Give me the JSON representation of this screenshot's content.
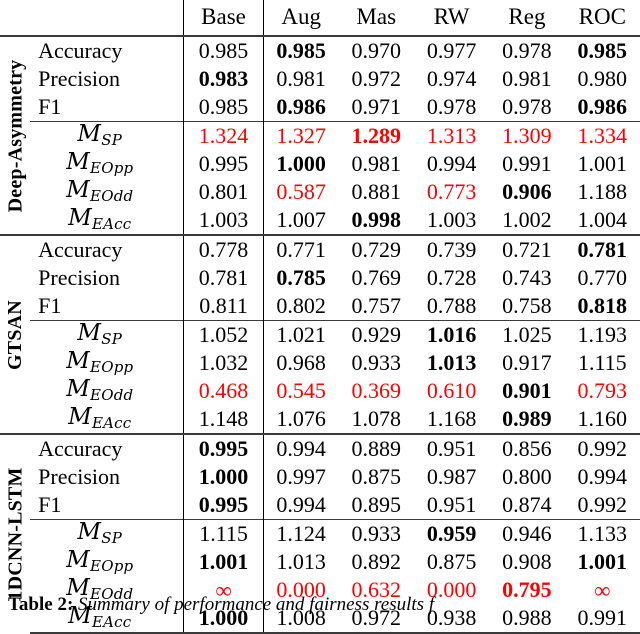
{
  "table": {
    "columns": [
      "Base",
      "Aug",
      "Mas",
      "RW",
      "Reg",
      "ROC"
    ],
    "row_label_header": "",
    "groups": [
      {
        "name": "Deep-Asymmetry",
        "perf_rows": [
          {
            "label": "Accuracy",
            "type": "plain",
            "cells": [
              {
                "text": "0.985",
                "bold": false,
                "red": false
              },
              {
                "text": "0.985",
                "bold": true,
                "red": false
              },
              {
                "text": "0.970",
                "bold": false,
                "red": false
              },
              {
                "text": "0.977",
                "bold": false,
                "red": false
              },
              {
                "text": "0.978",
                "bold": false,
                "red": false
              },
              {
                "text": "0.985",
                "bold": true,
                "red": false
              }
            ]
          },
          {
            "label": "Precision",
            "type": "plain",
            "cells": [
              {
                "text": "0.983",
                "bold": true,
                "red": false
              },
              {
                "text": "0.981",
                "bold": false,
                "red": false
              },
              {
                "text": "0.972",
                "bold": false,
                "red": false
              },
              {
                "text": "0.974",
                "bold": false,
                "red": false
              },
              {
                "text": "0.981",
                "bold": false,
                "red": false
              },
              {
                "text": "0.980",
                "bold": false,
                "red": false
              }
            ]
          },
          {
            "label": "F1",
            "type": "plain",
            "cells": [
              {
                "text": "0.985",
                "bold": false,
                "red": false
              },
              {
                "text": "0.986",
                "bold": true,
                "red": false
              },
              {
                "text": "0.971",
                "bold": false,
                "red": false
              },
              {
                "text": "0.978",
                "bold": false,
                "red": false
              },
              {
                "text": "0.978",
                "bold": false,
                "red": false
              },
              {
                "text": "0.986",
                "bold": true,
                "red": false
              }
            ]
          }
        ],
        "fair_rows": [
          {
            "label": "M",
            "sub": "SP",
            "type": "math",
            "cells": [
              {
                "text": "1.324",
                "bold": false,
                "red": true
              },
              {
                "text": "1.327",
                "bold": false,
                "red": true
              },
              {
                "text": "1.289",
                "bold": true,
                "red": true
              },
              {
                "text": "1.313",
                "bold": false,
                "red": true
              },
              {
                "text": "1.309",
                "bold": false,
                "red": true
              },
              {
                "text": "1.334",
                "bold": false,
                "red": true
              }
            ]
          },
          {
            "label": "M",
            "sub": "EOpp",
            "type": "math",
            "cells": [
              {
                "text": "0.995",
                "bold": false,
                "red": false
              },
              {
                "text": "1.000",
                "bold": true,
                "red": false
              },
              {
                "text": "0.981",
                "bold": false,
                "red": false
              },
              {
                "text": "0.994",
                "bold": false,
                "red": false
              },
              {
                "text": "0.991",
                "bold": false,
                "red": false
              },
              {
                "text": "1.001",
                "bold": false,
                "red": false
              }
            ]
          },
          {
            "label": "M",
            "sub": "EOdd",
            "type": "math",
            "cells": [
              {
                "text": "0.801",
                "bold": false,
                "red": false
              },
              {
                "text": "0.587",
                "bold": false,
                "red": true
              },
              {
                "text": "0.881",
                "bold": false,
                "red": false
              },
              {
                "text": "0.773",
                "bold": false,
                "red": true
              },
              {
                "text": "0.906",
                "bold": true,
                "red": false
              },
              {
                "text": "1.188",
                "bold": false,
                "red": false
              }
            ]
          },
          {
            "label": "M",
            "sub": "EAcc",
            "type": "math",
            "cells": [
              {
                "text": "1.003",
                "bold": false,
                "red": false
              },
              {
                "text": "1.007",
                "bold": false,
                "red": false
              },
              {
                "text": "0.998",
                "bold": true,
                "red": false
              },
              {
                "text": "1.003",
                "bold": false,
                "red": false
              },
              {
                "text": "1.002",
                "bold": false,
                "red": false
              },
              {
                "text": "1.004",
                "bold": false,
                "red": false
              }
            ]
          }
        ]
      },
      {
        "name": "GTSAN",
        "perf_rows": [
          {
            "label": "Accuracy",
            "type": "plain",
            "cells": [
              {
                "text": "0.778",
                "bold": false,
                "red": false
              },
              {
                "text": "0.771",
                "bold": false,
                "red": false
              },
              {
                "text": "0.729",
                "bold": false,
                "red": false
              },
              {
                "text": "0.739",
                "bold": false,
                "red": false
              },
              {
                "text": "0.721",
                "bold": false,
                "red": false
              },
              {
                "text": "0.781",
                "bold": true,
                "red": false
              }
            ]
          },
          {
            "label": "Precision",
            "type": "plain",
            "cells": [
              {
                "text": "0.781",
                "bold": false,
                "red": false
              },
              {
                "text": "0.785",
                "bold": true,
                "red": false
              },
              {
                "text": "0.769",
                "bold": false,
                "red": false
              },
              {
                "text": "0.728",
                "bold": false,
                "red": false
              },
              {
                "text": "0.743",
                "bold": false,
                "red": false
              },
              {
                "text": "0.770",
                "bold": false,
                "red": false
              }
            ]
          },
          {
            "label": "F1",
            "type": "plain",
            "cells": [
              {
                "text": "0.811",
                "bold": false,
                "red": false
              },
              {
                "text": "0.802",
                "bold": false,
                "red": false
              },
              {
                "text": "0.757",
                "bold": false,
                "red": false
              },
              {
                "text": "0.788",
                "bold": false,
                "red": false
              },
              {
                "text": "0.758",
                "bold": false,
                "red": false
              },
              {
                "text": "0.818",
                "bold": true,
                "red": false
              }
            ]
          }
        ],
        "fair_rows": [
          {
            "label": "M",
            "sub": "SP",
            "type": "math",
            "cells": [
              {
                "text": "1.052",
                "bold": false,
                "red": false
              },
              {
                "text": "1.021",
                "bold": false,
                "red": false
              },
              {
                "text": "0.929",
                "bold": false,
                "red": false
              },
              {
                "text": "1.016",
                "bold": true,
                "red": false
              },
              {
                "text": "1.025",
                "bold": false,
                "red": false
              },
              {
                "text": "1.193",
                "bold": false,
                "red": false
              }
            ]
          },
          {
            "label": "M",
            "sub": "EOpp",
            "type": "math",
            "cells": [
              {
                "text": "1.032",
                "bold": false,
                "red": false
              },
              {
                "text": "0.968",
                "bold": false,
                "red": false
              },
              {
                "text": "0.933",
                "bold": false,
                "red": false
              },
              {
                "text": "1.013",
                "bold": true,
                "red": false
              },
              {
                "text": "0.917",
                "bold": false,
                "red": false
              },
              {
                "text": "1.115",
                "bold": false,
                "red": false
              }
            ]
          },
          {
            "label": "M",
            "sub": "EOdd",
            "type": "math",
            "cells": [
              {
                "text": "0.468",
                "bold": false,
                "red": true
              },
              {
                "text": "0.545",
                "bold": false,
                "red": true
              },
              {
                "text": "0.369",
                "bold": false,
                "red": true
              },
              {
                "text": "0.610",
                "bold": false,
                "red": true
              },
              {
                "text": "0.901",
                "bold": true,
                "red": false
              },
              {
                "text": "0.793",
                "bold": false,
                "red": true
              }
            ]
          },
          {
            "label": "M",
            "sub": "EAcc",
            "type": "math",
            "cells": [
              {
                "text": "1.148",
                "bold": false,
                "red": false
              },
              {
                "text": "1.076",
                "bold": false,
                "red": false
              },
              {
                "text": "1.078",
                "bold": false,
                "red": false
              },
              {
                "text": "1.168",
                "bold": false,
                "red": false
              },
              {
                "text": "0.989",
                "bold": true,
                "red": false
              },
              {
                "text": "1.160",
                "bold": false,
                "red": false
              }
            ]
          }
        ]
      },
      {
        "name": "1DCNN-LSTM",
        "perf_rows": [
          {
            "label": "Accuracy",
            "type": "plain",
            "cells": [
              {
                "text": "0.995",
                "bold": true,
                "red": false
              },
              {
                "text": "0.994",
                "bold": false,
                "red": false
              },
              {
                "text": "0.889",
                "bold": false,
                "red": false
              },
              {
                "text": "0.951",
                "bold": false,
                "red": false
              },
              {
                "text": "0.856",
                "bold": false,
                "red": false
              },
              {
                "text": "0.992",
                "bold": false,
                "red": false
              }
            ]
          },
          {
            "label": "Precision",
            "type": "plain",
            "cells": [
              {
                "text": "1.000",
                "bold": true,
                "red": false
              },
              {
                "text": "0.997",
                "bold": false,
                "red": false
              },
              {
                "text": "0.875",
                "bold": false,
                "red": false
              },
              {
                "text": "0.987",
                "bold": false,
                "red": false
              },
              {
                "text": "0.800",
                "bold": false,
                "red": false
              },
              {
                "text": "0.994",
                "bold": false,
                "red": false
              }
            ]
          },
          {
            "label": "F1",
            "type": "plain",
            "cells": [
              {
                "text": "0.995",
                "bold": true,
                "red": false
              },
              {
                "text": "0.994",
                "bold": false,
                "red": false
              },
              {
                "text": "0.895",
                "bold": false,
                "red": false
              },
              {
                "text": "0.951",
                "bold": false,
                "red": false
              },
              {
                "text": "0.874",
                "bold": false,
                "red": false
              },
              {
                "text": "0.992",
                "bold": false,
                "red": false
              }
            ]
          }
        ],
        "fair_rows": [
          {
            "label": "M",
            "sub": "SP",
            "type": "math",
            "cells": [
              {
                "text": "1.115",
                "bold": false,
                "red": false
              },
              {
                "text": "1.124",
                "bold": false,
                "red": false
              },
              {
                "text": "0.933",
                "bold": false,
                "red": false
              },
              {
                "text": "0.959",
                "bold": true,
                "red": false
              },
              {
                "text": "0.946",
                "bold": false,
                "red": false
              },
              {
                "text": "1.133",
                "bold": false,
                "red": false
              }
            ]
          },
          {
            "label": "M",
            "sub": "EOpp",
            "type": "math",
            "cells": [
              {
                "text": "1.001",
                "bold": true,
                "red": false
              },
              {
                "text": "1.013",
                "bold": false,
                "red": false
              },
              {
                "text": "0.892",
                "bold": false,
                "red": false
              },
              {
                "text": "0.875",
                "bold": false,
                "red": false
              },
              {
                "text": "0.908",
                "bold": false,
                "red": false
              },
              {
                "text": "1.001",
                "bold": true,
                "red": false
              }
            ]
          },
          {
            "label": "M",
            "sub": "EOdd",
            "type": "math",
            "cells": [
              {
                "text": "∞",
                "bold": false,
                "red": true
              },
              {
                "text": "0.000",
                "bold": false,
                "red": true
              },
              {
                "text": "0.632",
                "bold": false,
                "red": true
              },
              {
                "text": "0.000",
                "bold": false,
                "red": true
              },
              {
                "text": "0.795",
                "bold": true,
                "red": true
              },
              {
                "text": "∞",
                "bold": false,
                "red": true
              }
            ]
          },
          {
            "label": "M",
            "sub": "EAcc",
            "type": "math",
            "cells": [
              {
                "text": "1.000",
                "bold": true,
                "red": false
              },
              {
                "text": "1.008",
                "bold": false,
                "red": false
              },
              {
                "text": "0.972",
                "bold": false,
                "red": false
              },
              {
                "text": "0.938",
                "bold": false,
                "red": false
              },
              {
                "text": "0.988",
                "bold": false,
                "red": false
              },
              {
                "text": "0.991",
                "bold": false,
                "red": false
              }
            ]
          }
        ]
      }
    ]
  },
  "caption": {
    "label": "Table 2:",
    "text": "Summary of performance and fairness results f"
  },
  "colors": {
    "red": "#fe0000",
    "rule": "#3a3a3a",
    "text": "#000000"
  }
}
